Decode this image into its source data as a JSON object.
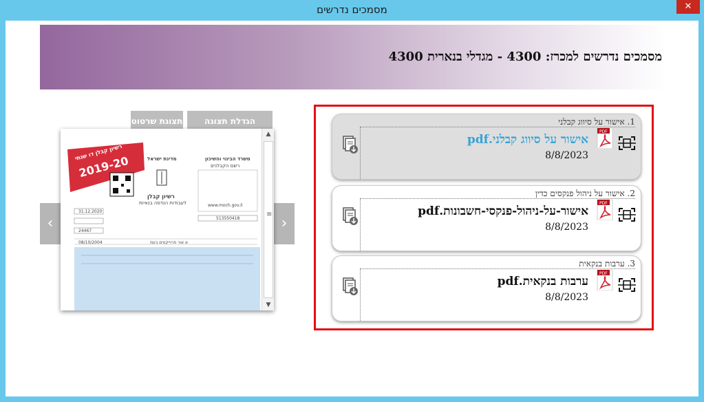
{
  "window": {
    "title": "מסמכים נדרשים",
    "close_label": "✕"
  },
  "banner": {
    "title": "מסמכים נדרשים למכרז: 4300 - מגדלי בנארית 4300"
  },
  "toolbar": {
    "zoom_label": "הגדלת תצוגה",
    "sketch_label": "תצוגת שרטוט"
  },
  "nav": {
    "prev": "‹",
    "next": "›"
  },
  "documents": [
    {
      "label": "1. אישור על סיווג קבלני",
      "file_name": "אישור על סיווג קבלני.pdf",
      "date": "8/8/2023"
    },
    {
      "label": "2. אישור על ניהול פנקסים כדין",
      "file_name": "אישור-על-ניהול-פנקסי-חשבונות.pdf",
      "date": "8/8/2023"
    },
    {
      "label": "3. ערבות בנקאית",
      "file_name": "ערבות בנקאית.pdf",
      "date": "8/8/2023"
    }
  ],
  "preview_doc": {
    "ribbon_top": "רשיון קבלן דו שנתי",
    "ribbon_year": "2019-20",
    "ministry": "משרד הבינוי והשיכון",
    "registry": "רשם הקבלנים",
    "state": "מדינת ישראל",
    "license_title": "רשיון קבלן",
    "license_sub": "לעבודות הנדסה בנאיות",
    "valid_until": "31.12.2020",
    "reg_number": "24467",
    "company_id": "513550418",
    "date_issued": "08/10/2004",
    "company_name": "א אור פרוייקטים בעמ",
    "web": "www.moch.gov.il"
  },
  "icons": {
    "download": "download-document-icon",
    "pdf": "pdf-file-icon",
    "scan": "scan-icon"
  },
  "colors": {
    "frame": "#e30d13",
    "link": "#35a3d8",
    "window_border": "#67c8ec",
    "close": "#c7291f"
  }
}
